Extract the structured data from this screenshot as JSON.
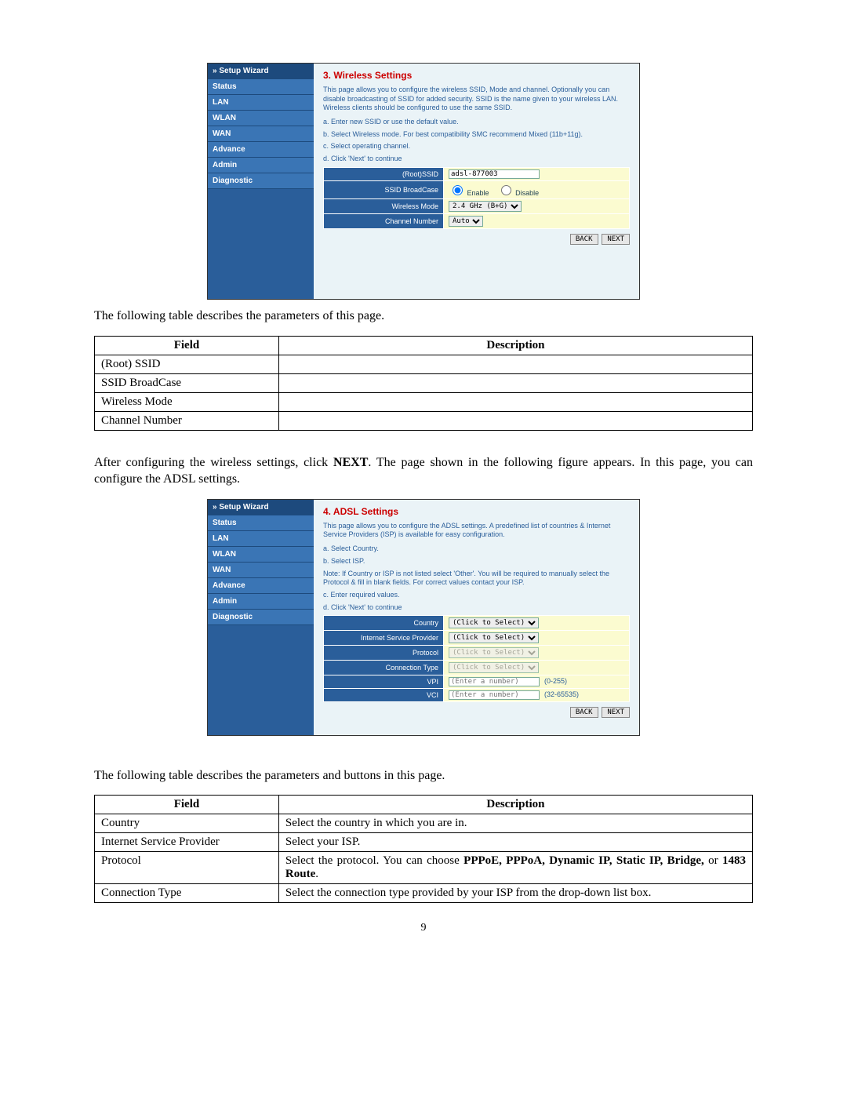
{
  "nav": {
    "items": [
      {
        "label": "» Setup Wizard"
      },
      {
        "label": "Status"
      },
      {
        "label": "LAN"
      },
      {
        "label": "WLAN"
      },
      {
        "label": "WAN"
      },
      {
        "label": "Advance"
      },
      {
        "label": "Admin"
      },
      {
        "label": "Diagnostic"
      }
    ]
  },
  "wireless": {
    "title": "3. Wireless Settings",
    "intro": "This page allows you to configure the wireless SSID, Mode and channel. Optionally you can disable broadcasting of SSID for added security. SSID is the name given to your wireless LAN. Wireless clients should be configured to use the same SSID.",
    "step_a": "a. Enter new SSID or use the default value.",
    "step_b": "b. Select Wireless mode. For best compatibility SMC recommend Mixed (11b+11g).",
    "step_c": "c. Select operating channel.",
    "step_d": "d. Click 'Next' to continue",
    "form": {
      "ssid_label": "(Root)SSID",
      "ssid_value": "adsl-877003",
      "broadcast_label": "SSID BroadCase",
      "broadcast_enable": "Enable",
      "broadcast_disable": "Disable",
      "mode_label": "Wireless Mode",
      "mode_value": "2.4 GHz (B+G)",
      "channel_label": "Channel Number",
      "channel_value": "Auto"
    },
    "btn_back": "BACK",
    "btn_next": "NEXT"
  },
  "para1": "The following table describes the parameters of this page.",
  "table1": {
    "head_field": "Field",
    "head_desc": "Description",
    "rows": [
      {
        "field": "(Root) SSID",
        "desc": ""
      },
      {
        "field": "SSID BroadCase",
        "desc": ""
      },
      {
        "field": "Wireless Mode",
        "desc": ""
      },
      {
        "field": "Channel Number",
        "desc": ""
      }
    ]
  },
  "para2_a": "After configuring the wireless settings, click ",
  "para2_bold": "NEXT",
  "para2_b": ". The page shown in the following figure appears. In this page, you can configure the ADSL settings.",
  "adsl": {
    "title": "4. ADSL Settings",
    "intro": "This page allows you to configure the ADSL settings. A predefined list of countries & Internet Service Providers (ISP) is available for easy configuration.",
    "step_a": "a. Select Country.",
    "step_b": "b. Select ISP.",
    "note": "Note: If Country or ISP is not listed select 'Other'. You will be required to manually select the Protocol & fill in blank fields. For correct values contact your ISP.",
    "step_c": "c. Enter required values.",
    "step_d": "d. Click 'Next' to continue",
    "form": {
      "country_label": "Country",
      "country_value": "(Click to Select)",
      "isp_label": "Internet Service Provider",
      "isp_value": "(Click to Select)",
      "protocol_label": "Protocol",
      "protocol_value": "(Click to Select)",
      "conn_label": "Connection Type",
      "conn_value": "(Click to Select)",
      "vpi_label": "VPI",
      "vpi_placeholder": "(Enter a number)",
      "vpi_hint": "(0-255)",
      "vci_label": "VCI",
      "vci_placeholder": "(Enter a number)",
      "vci_hint": "(32-65535)"
    },
    "btn_back": "BACK",
    "btn_next": "NEXT"
  },
  "para3": "The following table describes the parameters and buttons in this page.",
  "table2": {
    "head_field": "Field",
    "head_desc": "Description",
    "rows": [
      {
        "field": "Country",
        "desc": "Select the country in which you are in."
      },
      {
        "field": "Internet Service Provider",
        "desc": "Select your ISP."
      },
      {
        "field": "Protocol",
        "desc_a": "Select the protocol. You can choose ",
        "desc_bold": "PPPoE, PPPoA, Dynamic IP, Static IP, Bridge, ",
        "desc_b": "or ",
        "desc_bold2": "1483 Route",
        "desc_c": "."
      },
      {
        "field": "Connection Type",
        "desc": "Select the connection type provided by your ISP from the drop-down list box."
      }
    ]
  },
  "page_no": "9"
}
